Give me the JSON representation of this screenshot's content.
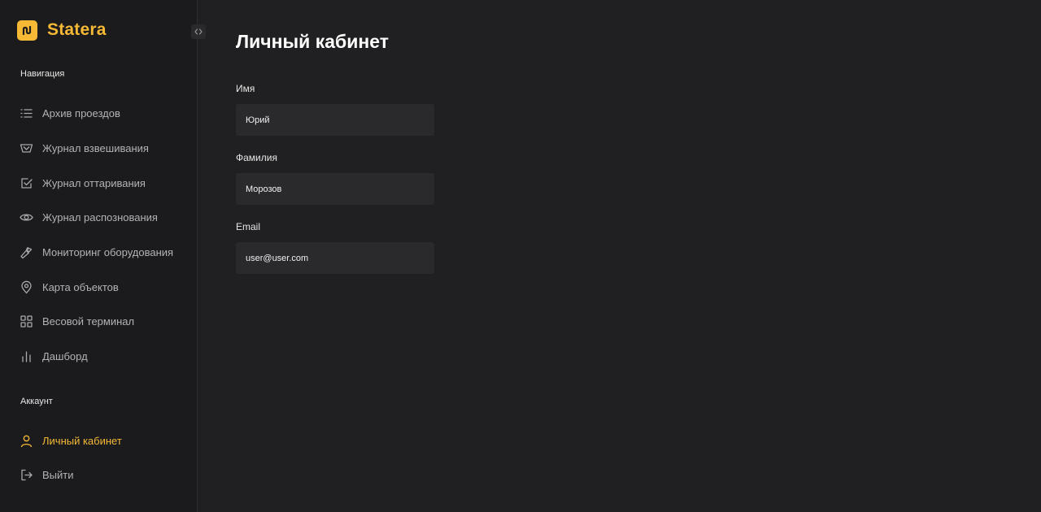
{
  "brand": {
    "name": "Statera",
    "accent_color": "#f5b935"
  },
  "sidebar": {
    "navigation_title": "Навигация",
    "nav_items": [
      {
        "label": "Архив проездов",
        "icon": "list-icon"
      },
      {
        "label": "Журнал взвешивания",
        "icon": "scale-icon"
      },
      {
        "label": "Журнал оттаривания",
        "icon": "checkbox-icon"
      },
      {
        "label": "Журнал распознования",
        "icon": "eye-icon"
      },
      {
        "label": "Мониторинг оборудования",
        "icon": "wrench-icon"
      },
      {
        "label": "Карта объектов",
        "icon": "map-pin-icon"
      },
      {
        "label": "Весовой терминал",
        "icon": "grid-icon"
      },
      {
        "label": "Дашборд",
        "icon": "bar-chart-icon"
      }
    ],
    "account_title": "Аккаунт",
    "account_items": [
      {
        "label": "Личный кабинет",
        "icon": "user-icon",
        "active": true
      },
      {
        "label": "Выйти",
        "icon": "logout-icon",
        "active": false
      }
    ]
  },
  "main": {
    "title": "Личный кабинет",
    "fields": [
      {
        "label": "Имя",
        "value": "Юрий"
      },
      {
        "label": "Фамилия",
        "value": "Морозов"
      },
      {
        "label": "Email",
        "value": "user@user.com"
      }
    ]
  }
}
